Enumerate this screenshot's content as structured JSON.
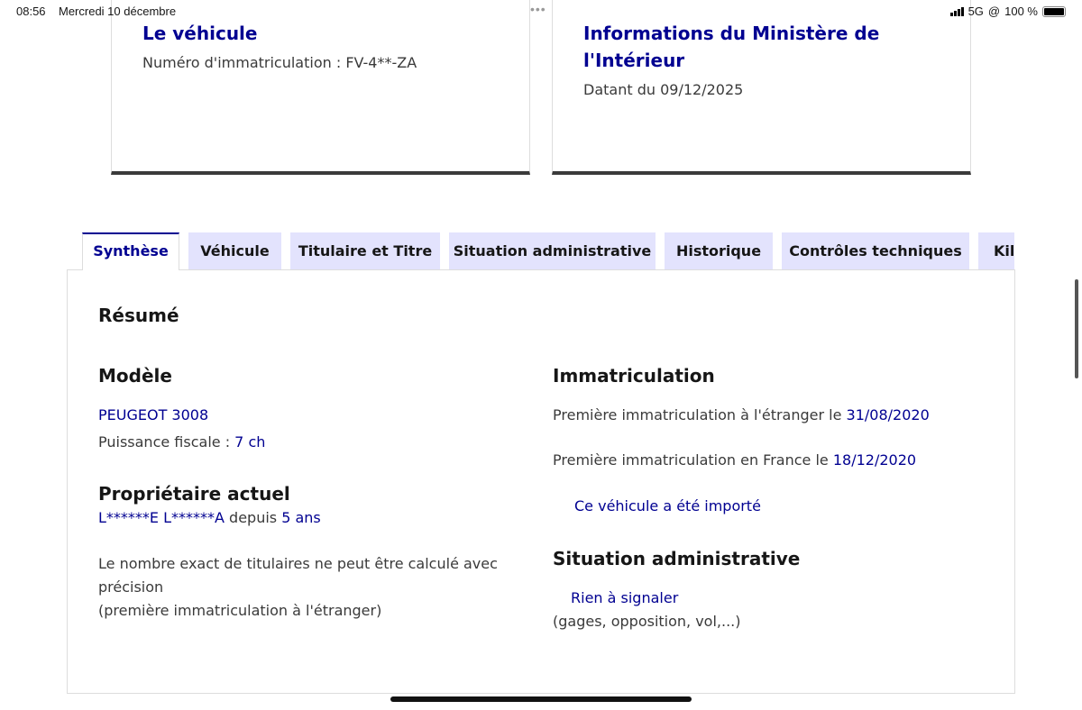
{
  "status_bar": {
    "time": "08:56",
    "date": "Mercredi 10 décembre",
    "network": "5G",
    "battery": "100 %"
  },
  "cards": [
    {
      "title": "Le véhicule",
      "text": "Numéro d'immatriculation : FV-4**-ZA"
    },
    {
      "title": "Informations du Ministère de l'Intérieur",
      "text": "Datant du 09/12/2025"
    }
  ],
  "tabs": [
    {
      "label": "Synthèse",
      "active": true
    },
    {
      "label": "Véhicule"
    },
    {
      "label": "Titulaire et Titre"
    },
    {
      "label": "Situation administrative"
    },
    {
      "label": "Historique"
    },
    {
      "label": "Contrôles techniques"
    },
    {
      "label": "Kilométrage"
    }
  ],
  "summary": {
    "title": "Résumé",
    "model": {
      "heading": "Modèle",
      "name": "PEUGEOT 3008",
      "power_label": "Puissance fiscale : ",
      "power_value": "7 ch"
    },
    "owner": {
      "heading": "Propriétaire actuel",
      "name": "L******E L******A",
      "since_label": " depuis ",
      "since_value": "5 ans",
      "note_line1": "Le nombre exact de titulaires ne peut être calculé avec",
      "note_line2": "précision",
      "note_line3": "(première immatriculation à l'étranger)"
    },
    "registration": {
      "heading": "Immatriculation",
      "foreign_label": "Première immatriculation à l'étranger le ",
      "foreign_date": "31/08/2020",
      "france_label": "Première immatriculation en France le ",
      "france_date": "18/12/2020",
      "imported": "Ce véhicule a été importé"
    },
    "admin": {
      "heading": "Situation administrative",
      "status": "Rien à signaler",
      "details": "(gages, opposition, vol,...)"
    }
  },
  "colors": {
    "accent": "#000091",
    "tab_bg": "#e3e3fd"
  }
}
